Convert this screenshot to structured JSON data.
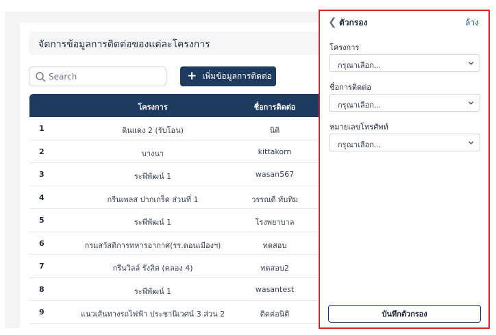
{
  "page": {
    "title": "จัดการข้อมูลการติดต่อของแต่ละโครงการ"
  },
  "search": {
    "placeholder": "Search",
    "value": ""
  },
  "toolbar": {
    "add_label": "เพิ่มข้อมูลการติดต่อ",
    "add_icon": "plus-icon"
  },
  "table": {
    "headers": {
      "project": "โครงการ",
      "contact": "ชื่อการติดต่อ"
    },
    "rows": [
      {
        "idx": "1",
        "project": "ดินแดง 2 (รับโอน)",
        "contact": "นิติ"
      },
      {
        "idx": "2",
        "project": "บางนา",
        "contact": "kittakorn"
      },
      {
        "idx": "3",
        "project": "ระพีพัฒน์ 1",
        "contact": "wasan567"
      },
      {
        "idx": "4",
        "project": "กรีนเพลส ปากเกร็ด ส่วนที่ 1",
        "contact": "วรรณดี ทับทิม"
      },
      {
        "idx": "5",
        "project": "ระพีพัฒน์ 1",
        "contact": "โรงพยาบาล"
      },
      {
        "idx": "6",
        "project": "กรมสวัสดิการทหารอากาศ(รร.ดอนเมืองฯ)",
        "contact": "ทดสอบ"
      },
      {
        "idx": "7",
        "project": "กรีนวิลล์ รังสิต (คลอง 4)",
        "contact": "ทดสอบ2"
      },
      {
        "idx": "8",
        "project": "ระพีพัฒน์ 1",
        "contact": "wasantest"
      },
      {
        "idx": "9",
        "project": "แนวเส้นทางรถไฟฟ้า ประชานิเวศน์ 3 ส่วน 2",
        "contact": "ติดต่อนิติ"
      }
    ]
  },
  "filter": {
    "title": "ตัวกรอง",
    "clear_label": "ล้าง",
    "fields": [
      {
        "label": "โครงการ",
        "selected": "กรุณาเลือก..."
      },
      {
        "label": "ชื่อการติดต่อ",
        "selected": "กรุณาเลือก..."
      },
      {
        "label": "หมายเลขโทรศัพท์",
        "selected": "กรุณาเลือก..."
      }
    ],
    "save_label": "บันทึกตัวกรอง"
  },
  "colors": {
    "primary": "#1e3a5f",
    "highlight_border": "#e11d2a",
    "link": "#1e4f8a"
  }
}
